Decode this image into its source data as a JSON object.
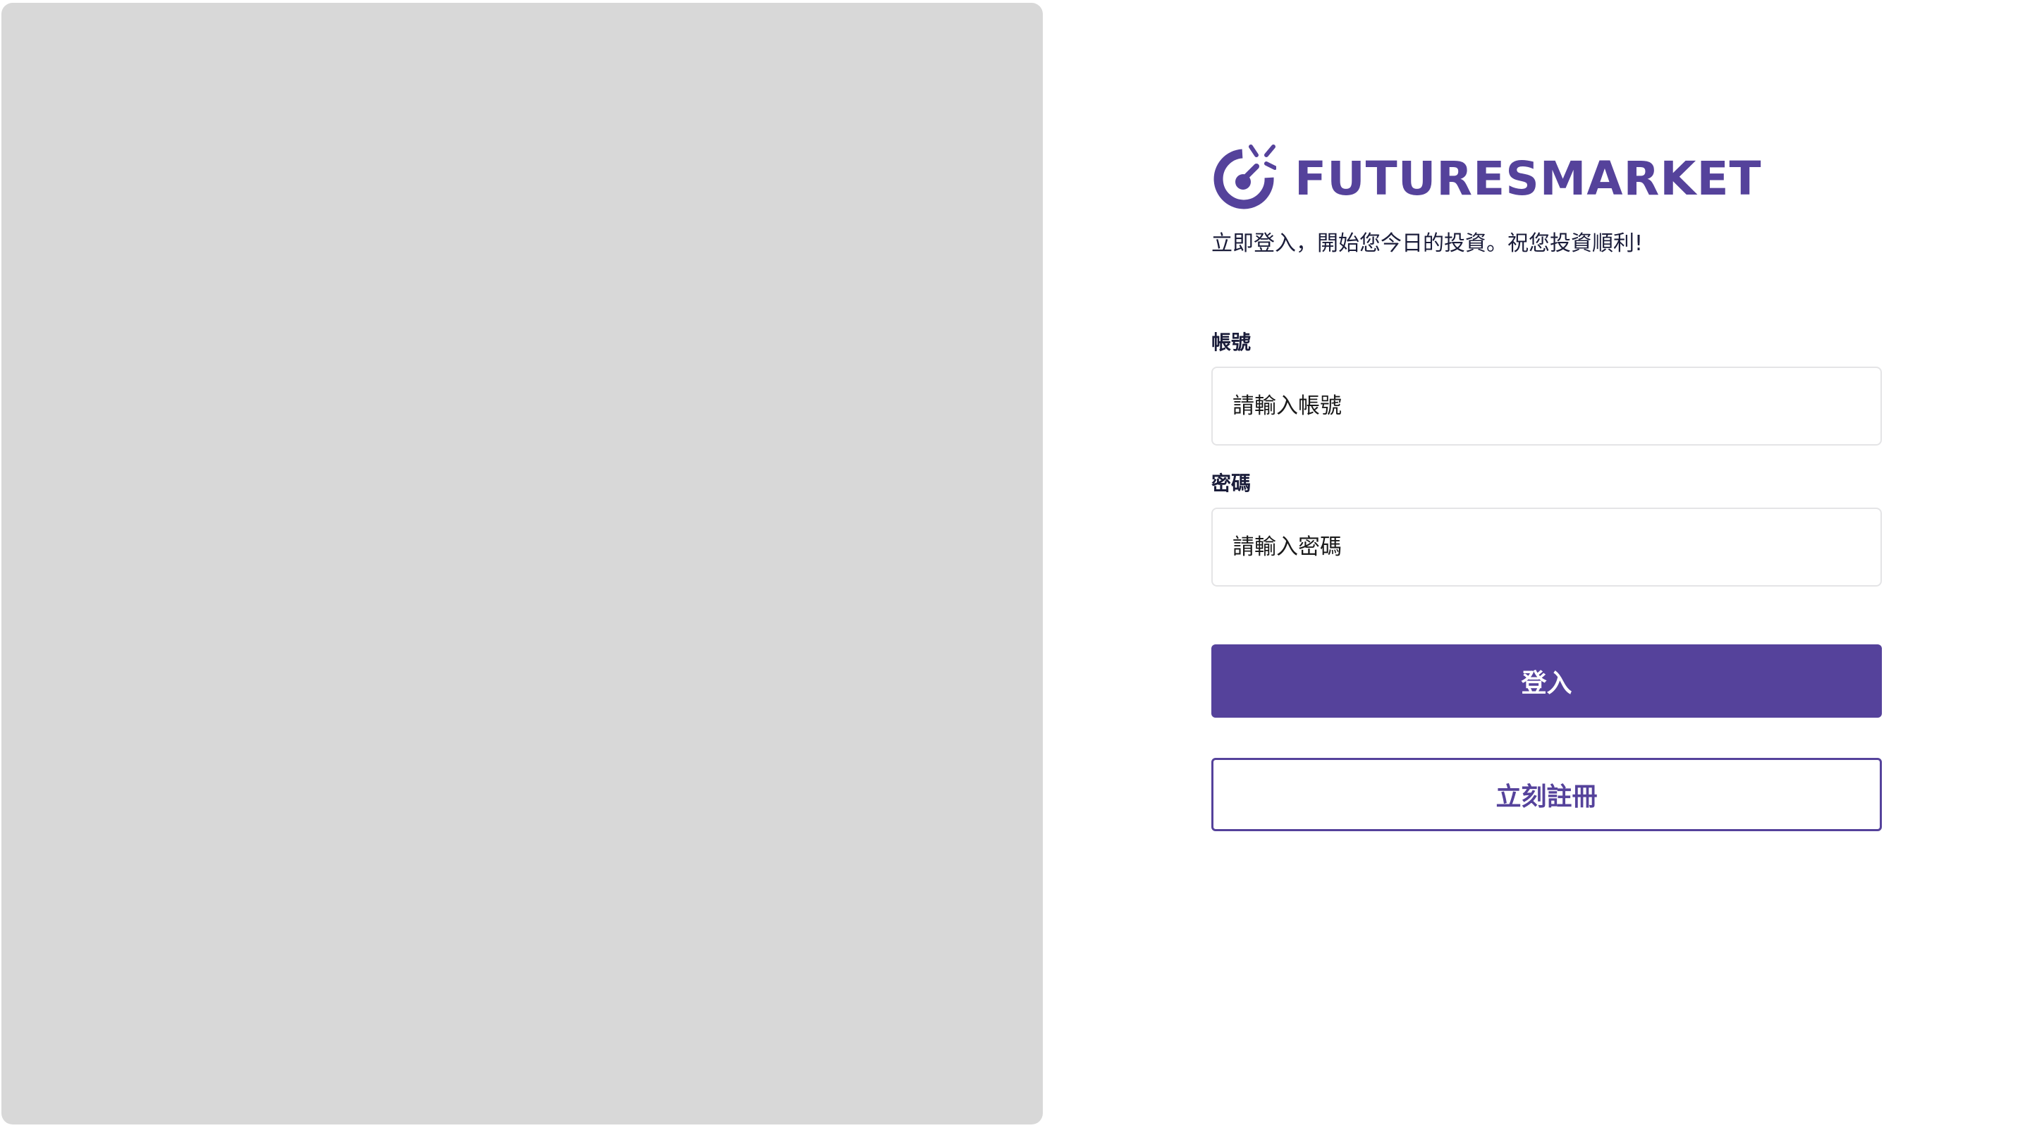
{
  "brand": {
    "name": "FUTURESMARKET",
    "color": "#55429b",
    "logo_icon": "futuresmarket-logo-icon"
  },
  "login": {
    "tagline": "立即登入，開始您今日的投資。祝您投資順利!",
    "account": {
      "label": "帳號",
      "placeholder": "請輸入帳號",
      "value": ""
    },
    "password": {
      "label": "密碼",
      "placeholder": "請輸入密碼",
      "value": ""
    },
    "login_button": "登入",
    "register_button": "立刻註冊"
  },
  "colors": {
    "hero_background": "#d8d8d8",
    "primary": "#55429b",
    "text": "#1b1d3a",
    "input_border": "#e4e4e6"
  }
}
